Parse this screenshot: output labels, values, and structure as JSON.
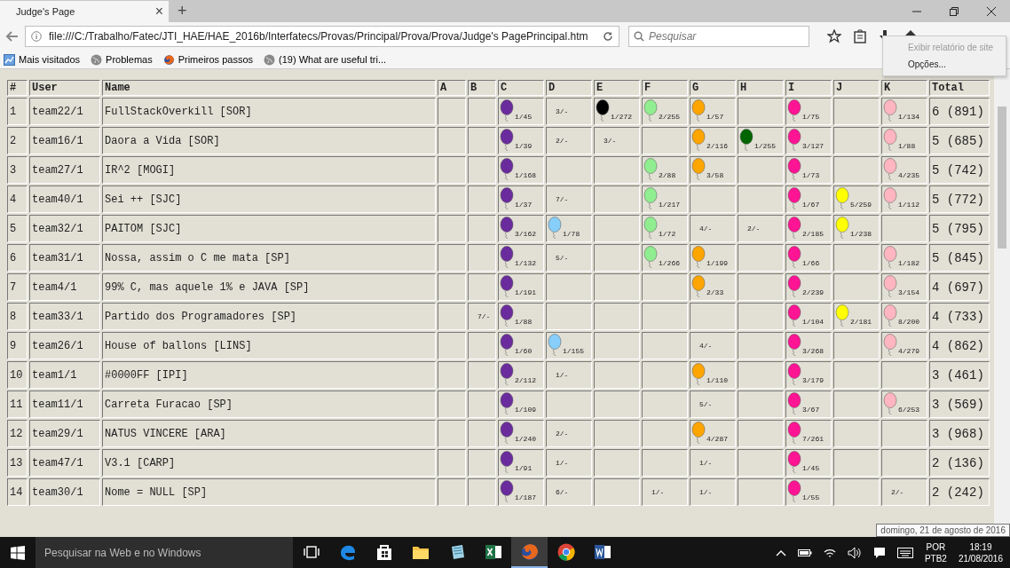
{
  "browser": {
    "tab": {
      "title": "Judge's Page",
      "close": "×"
    },
    "new_tab": "+",
    "url": "file:///C:/Trabalho/Fatec/JTI_HAE/HAE_2016b/Interfatecs/Provas/Principal/Prova/Prova/Judge's PagePrincipal.htm",
    "search": {
      "placeholder": "Pesquisar"
    },
    "bookmarks": [
      {
        "kind": "visited",
        "label": "Mais visitados"
      },
      {
        "kind": "globe",
        "label": "Problemas"
      },
      {
        "kind": "firefox",
        "label": "Primeiros passos"
      },
      {
        "kind": "globe",
        "label": "(19) What are useful tri..."
      }
    ],
    "menu": [
      {
        "label": "Exibir relatório de site",
        "disabled": true
      },
      {
        "label": "Opções...",
        "disabled": false
      }
    ]
  },
  "table": {
    "columns": [
      "#",
      "User",
      "Name",
      "A",
      "B",
      "C",
      "D",
      "E",
      "F",
      "G",
      "H",
      "I",
      "J",
      "K",
      "Total"
    ],
    "rows": [
      [
        "1",
        "team22/1",
        "FullStackOverkill [SOR]",
        "",
        "",
        {
          "kind": "balloon",
          "text": "1/45",
          "color": "#6a2c9c"
        },
        {
          "kind": "tries",
          "text": "3/-"
        },
        {
          "kind": "balloon",
          "text": "1/272",
          "color": "#000000"
        },
        {
          "kind": "balloon",
          "text": "2/255",
          "color": "#90ee90"
        },
        {
          "kind": "balloon",
          "text": "1/57",
          "color": "#ffa500"
        },
        "",
        {
          "kind": "balloon",
          "text": "1/75",
          "color": "#ff1493"
        },
        "",
        {
          "kind": "balloon",
          "text": "1/134",
          "color": "#ffb6c1"
        },
        "6 (891)"
      ],
      [
        "2",
        "team16/1",
        "Daora a Vida [SOR]",
        "",
        "",
        {
          "kind": "balloon",
          "text": "1/39",
          "color": "#6a2c9c"
        },
        {
          "kind": "tries",
          "text": "2/-"
        },
        {
          "kind": "tries",
          "text": "3/-"
        },
        "",
        {
          "kind": "balloon",
          "text": "2/116",
          "color": "#ffa500"
        },
        {
          "kind": "balloon",
          "text": "1/255",
          "color": "#006400"
        },
        {
          "kind": "balloon",
          "text": "3/127",
          "color": "#ff1493"
        },
        "",
        {
          "kind": "balloon",
          "text": "1/88",
          "color": "#ffb6c1"
        },
        "5 (685)"
      ],
      [
        "3",
        "team27/1",
        "IR^2 [MOGI]",
        "",
        "",
        {
          "kind": "balloon",
          "text": "1/168",
          "color": "#6a2c9c"
        },
        "",
        "",
        {
          "kind": "balloon",
          "text": "2/88",
          "color": "#90ee90"
        },
        {
          "kind": "balloon",
          "text": "3/58",
          "color": "#ffa500"
        },
        "",
        {
          "kind": "balloon",
          "text": "1/73",
          "color": "#ff1493"
        },
        "",
        {
          "kind": "balloon",
          "text": "4/235",
          "color": "#ffb6c1"
        },
        "5 (742)"
      ],
      [
        "4",
        "team40/1",
        "Sei ++ [SJC]",
        "",
        "",
        {
          "kind": "balloon",
          "text": "1/37",
          "color": "#6a2c9c"
        },
        {
          "kind": "tries",
          "text": "7/-"
        },
        "",
        {
          "kind": "balloon",
          "text": "1/217",
          "color": "#90ee90"
        },
        "",
        "",
        {
          "kind": "balloon",
          "text": "1/67",
          "color": "#ff1493"
        },
        {
          "kind": "balloon",
          "text": "5/259",
          "color": "#ffff00"
        },
        {
          "kind": "balloon",
          "text": "1/112",
          "color": "#ffb6c1"
        },
        "5 (772)"
      ],
      [
        "5",
        "team32/1",
        "PAITOM [SJC]",
        "",
        "",
        {
          "kind": "balloon",
          "text": "3/162",
          "color": "#6a2c9c"
        },
        {
          "kind": "balloon",
          "text": "1/78",
          "color": "#87cefa"
        },
        "",
        {
          "kind": "balloon",
          "text": "1/72",
          "color": "#90ee90"
        },
        {
          "kind": "tries",
          "text": "4/-"
        },
        {
          "kind": "tries",
          "text": "2/-"
        },
        {
          "kind": "balloon",
          "text": "2/185",
          "color": "#ff1493"
        },
        {
          "kind": "balloon",
          "text": "1/238",
          "color": "#ffff00"
        },
        "",
        "5 (795)"
      ],
      [
        "6",
        "team31/1",
        "Nossa, assim o C me mata [SP]",
        "",
        "",
        {
          "kind": "balloon",
          "text": "1/132",
          "color": "#6a2c9c"
        },
        {
          "kind": "tries",
          "text": "5/-"
        },
        "",
        {
          "kind": "balloon",
          "text": "1/266",
          "color": "#90ee90"
        },
        {
          "kind": "balloon",
          "text": "1/199",
          "color": "#ffa500"
        },
        "",
        {
          "kind": "balloon",
          "text": "1/66",
          "color": "#ff1493"
        },
        "",
        {
          "kind": "balloon",
          "text": "1/182",
          "color": "#ffb6c1"
        },
        "5 (845)"
      ],
      [
        "7",
        "team4/1",
        "99% C, mas aquele 1% e JAVA [SP]",
        "",
        "",
        {
          "kind": "balloon",
          "text": "1/191",
          "color": "#6a2c9c"
        },
        "",
        "",
        "",
        {
          "kind": "balloon",
          "text": "2/33",
          "color": "#ffa500"
        },
        "",
        {
          "kind": "balloon",
          "text": "2/239",
          "color": "#ff1493"
        },
        "",
        {
          "kind": "balloon",
          "text": "3/154",
          "color": "#ffb6c1"
        },
        "4 (697)"
      ],
      [
        "8",
        "team33/1",
        "Partido dos Programadores [SP]",
        "",
        {
          "kind": "tries",
          "text": "7/-"
        },
        {
          "kind": "balloon",
          "text": "1/88",
          "color": "#6a2c9c"
        },
        "",
        "",
        "",
        "",
        "",
        {
          "kind": "balloon",
          "text": "1/104",
          "color": "#ff1493"
        },
        {
          "kind": "balloon",
          "text": "2/181",
          "color": "#ffff00"
        },
        {
          "kind": "balloon",
          "text": "8/200",
          "color": "#ffb6c1"
        },
        "4 (733)"
      ],
      [
        "9",
        "team26/1",
        "House of ballons [LINS]",
        "",
        "",
        {
          "kind": "balloon",
          "text": "1/60",
          "color": "#6a2c9c"
        },
        {
          "kind": "balloon",
          "text": "1/155",
          "color": "#87cefa"
        },
        "",
        "",
        {
          "kind": "tries",
          "text": "4/-"
        },
        "",
        {
          "kind": "balloon",
          "text": "3/268",
          "color": "#ff1493"
        },
        "",
        {
          "kind": "balloon",
          "text": "4/279",
          "color": "#ffb6c1"
        },
        "4 (862)"
      ],
      [
        "10",
        "team1/1",
        "#0000FF [IPI]",
        "",
        "",
        {
          "kind": "balloon",
          "text": "2/112",
          "color": "#6a2c9c"
        },
        {
          "kind": "tries",
          "text": "1/-"
        },
        "",
        "",
        {
          "kind": "balloon",
          "text": "1/110",
          "color": "#ffa500"
        },
        "",
        {
          "kind": "balloon",
          "text": "3/179",
          "color": "#ff1493"
        },
        "",
        "",
        "3 (461)"
      ],
      [
        "11",
        "team11/1",
        "Carreta Furacao [SP]",
        "",
        "",
        {
          "kind": "balloon",
          "text": "1/109",
          "color": "#6a2c9c"
        },
        "",
        "",
        "",
        {
          "kind": "tries",
          "text": "5/-"
        },
        "",
        {
          "kind": "balloon",
          "text": "3/67",
          "color": "#ff1493"
        },
        "",
        {
          "kind": "balloon",
          "text": "6/253",
          "color": "#ffb6c1"
        },
        "3 (569)"
      ],
      [
        "12",
        "team29/1",
        "NATUS VINCERE [ARA]",
        "",
        "",
        {
          "kind": "balloon",
          "text": "1/240",
          "color": "#6a2c9c"
        },
        {
          "kind": "tries",
          "text": "2/-"
        },
        "",
        "",
        {
          "kind": "balloon",
          "text": "4/287",
          "color": "#ffa500"
        },
        "",
        {
          "kind": "balloon",
          "text": "7/261",
          "color": "#ff1493"
        },
        "",
        "",
        "3 (968)"
      ],
      [
        "13",
        "team47/1",
        "V3.1 [CARP]",
        "",
        "",
        {
          "kind": "balloon",
          "text": "1/91",
          "color": "#6a2c9c"
        },
        {
          "kind": "tries",
          "text": "1/-"
        },
        "",
        "",
        {
          "kind": "tries",
          "text": "1/-"
        },
        "",
        {
          "kind": "balloon",
          "text": "1/45",
          "color": "#ff1493"
        },
        "",
        "",
        "2 (136)"
      ],
      [
        "14",
        "team30/1",
        "Nome = NULL [SP]",
        "",
        "",
        {
          "kind": "balloon",
          "text": "1/187",
          "color": "#6a2c9c"
        },
        {
          "kind": "tries",
          "text": "6/-"
        },
        "",
        {
          "kind": "tries",
          "text": "1/-"
        },
        {
          "kind": "tries",
          "text": "1/-"
        },
        "",
        {
          "kind": "balloon",
          "text": "1/55",
          "color": "#ff1493"
        },
        "",
        {
          "kind": "tries",
          "text": "2/-"
        },
        "2 (242)"
      ]
    ]
  },
  "tooltip": "domingo, 21 de agosto de 2016",
  "taskbar": {
    "search": {
      "placeholder": "Pesquisar na Web e no Windows"
    },
    "apps": [
      {
        "kind": "taskview",
        "selected": false
      },
      {
        "kind": "edge",
        "selected": false
      },
      {
        "kind": "store",
        "selected": false
      },
      {
        "kind": "folder",
        "selected": false
      },
      {
        "kind": "notepad",
        "selected": false
      },
      {
        "kind": "excel",
        "selected": false
      },
      {
        "kind": "firefox",
        "selected": true
      },
      {
        "kind": "chrome",
        "selected": false
      },
      {
        "kind": "word",
        "selected": false
      }
    ],
    "language": [
      "POR",
      "PTB2"
    ],
    "time": "18:19",
    "date": "21/08/2016"
  }
}
